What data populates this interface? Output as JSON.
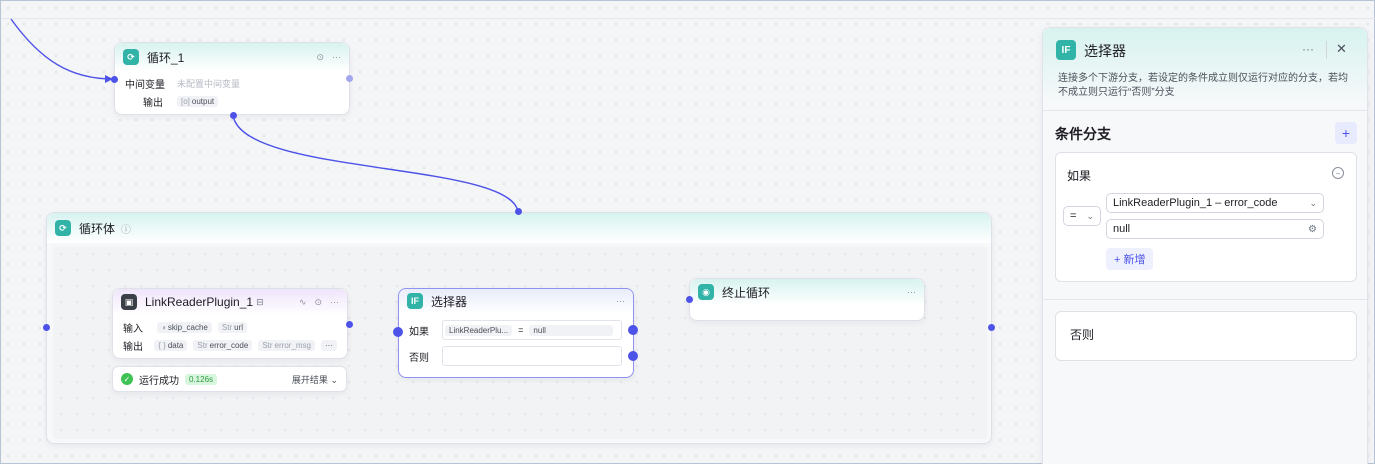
{
  "loop_node": {
    "title": "循环_1",
    "var_label": "中间变量",
    "var_placeholder": "未配置中间变量",
    "output_label": "输出",
    "output_tag_type": "[o]",
    "output_tag": "output"
  },
  "loop_body": {
    "title": "循环体"
  },
  "plugin_node": {
    "title": "LinkReaderPlugin_1",
    "input_label": "输入",
    "input_tags": [
      {
        "type": "",
        "name": "skip_cache"
      },
      {
        "type": "Str",
        "name": "url"
      }
    ],
    "output_label": "输出",
    "output_tags": [
      {
        "type": "{ }",
        "name": "data"
      },
      {
        "type": "Str",
        "name": "error_code"
      },
      {
        "type": "Str",
        "name": "error_msg"
      }
    ],
    "more": "···"
  },
  "run_status": {
    "label": "运行成功",
    "time": "0.126s",
    "expand": "展开结果"
  },
  "selector_node": {
    "title": "选择器",
    "if_label": "如果",
    "if_left": "LinkReaderPlu...",
    "if_op": "=",
    "if_right": "null",
    "else_label": "否则"
  },
  "stop_node": {
    "title": "终止循环"
  },
  "panel": {
    "icon": "IF",
    "title": "选择器",
    "description": "连接多个下游分支，若设定的条件成立则仅运行对应的分支，若均不成立则只运行“否则”分支",
    "section_title": "条件分支",
    "if_label": "如果",
    "operator": "=",
    "left_operand": "LinkReaderPlugin_1 – error_code",
    "right_operand": "null",
    "add_label": "+ 新增",
    "else_label": "否则"
  },
  "colors": {
    "accent": "#4d53e8",
    "teal": "#32b3a7",
    "success": "#3ec254"
  }
}
